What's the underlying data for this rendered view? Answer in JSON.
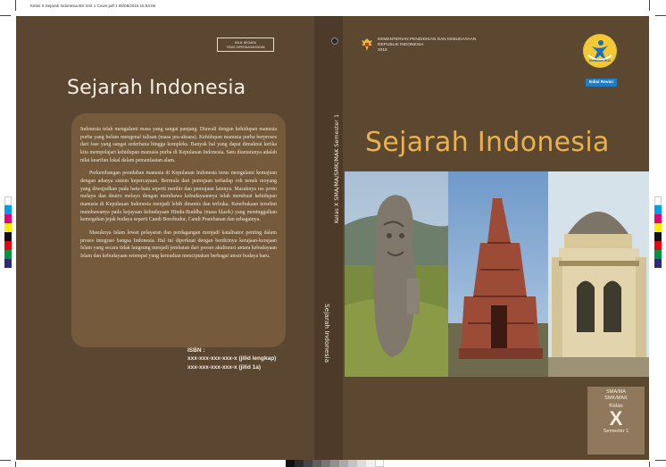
{
  "print_slug": "Kelas X Sejarah Indonesia BS Smt 1 Cover.pdf   1   05/08/2016   15:54:05",
  "back_cover": {
    "title": "Sejarah Indonesia",
    "label_box": [
      "MILIK NEGARA",
      "TIDAK DIPERDAGANGKAN"
    ],
    "blurb": [
      "Indonesia telah mengalami masa yang sangat panjang. Diawali dengan kehidupan manusia purba yang belum mengenal tulisan (masa pra-aksara). Kehidupan manusia purba berproses dari fase yang sangat sederhana hingga kompleks. Banyak hal yang dapat dimaknai ketika kita mempelajari kehidupan manusia purba di Kepulauan Indonesia. Satu diantaranya adalah nilai kearifan lokal dalam pemanfaatan alam.",
      "Perkembangan peradaban manusia di Kepulauan Indonesia terus mengalami kemajuan dengan adanya sistem kepercayaan. Bermula dari pemujaan terhadap roh nenek moyang yang diwujudkan pada batu-batu seperti menhir dan pemujaan lainnya. Masuknya ras proto melayu dan deutro melayu dengan membawa kebudayaannya telah membuat kehidupan manusia di Kepulauan Indonesia menjadi lebih dinamis dan terbuka. Keterbukaan tersebut membawanya pada kejayaan kebudayaan Hindu-Buddha (masa klasik) yang meninggalkan kemegahan jejak budaya seperti Candi Borobudur, Candi Prambanan dan sebagainya.",
      "Masuknya Islam lewat pelayaran dan perdagangan menjadi katalisator penting dalam proses integrasi bangsa Indonesia. Hal ini diperkuat dengan berdirinya kerajaan-kerajaan Islam yang secara tidak langsung menjadi jembatan dari proses akulturasi antara kebudayaan Islam dan kebudayaan setempat yang kemudian menciptakan berbagai unsur budaya baru."
    ],
    "isbn_label": "ISBN :",
    "isbn_lines": [
      "xxx-xxx-xxx-xxx-x (jilid lengkap)",
      "xxx-xxx-xxx-xxx-x (jilid 1a)"
    ]
  },
  "spine": {
    "title": "Sejarah Indonesia",
    "grade": "Kelas X  SMA/MA/SMK/MAK  Semester 1"
  },
  "front_cover": {
    "ministry_lines": [
      "KEMENTERIAN PENDIDIKAN DAN KEBUDAYAAN",
      "REPUBLIK INDONESIA",
      "2015"
    ],
    "logo_text": "Kurikulum 2013",
    "edition": "Edisi Revisi",
    "title": "Sejarah Indonesia",
    "level_lines": [
      "SMA/MA",
      "SMK/MAK"
    ],
    "kelas_label": "Kelas",
    "kelas_value": "X",
    "semester": "Semester 1"
  },
  "colors": {
    "cover_brown": "#5c4731",
    "spine_brown": "#4d3a28",
    "blurb_panel": "#755a3c",
    "title_gold": "#e9b24e",
    "edition_blue": "#1d7dc4"
  }
}
